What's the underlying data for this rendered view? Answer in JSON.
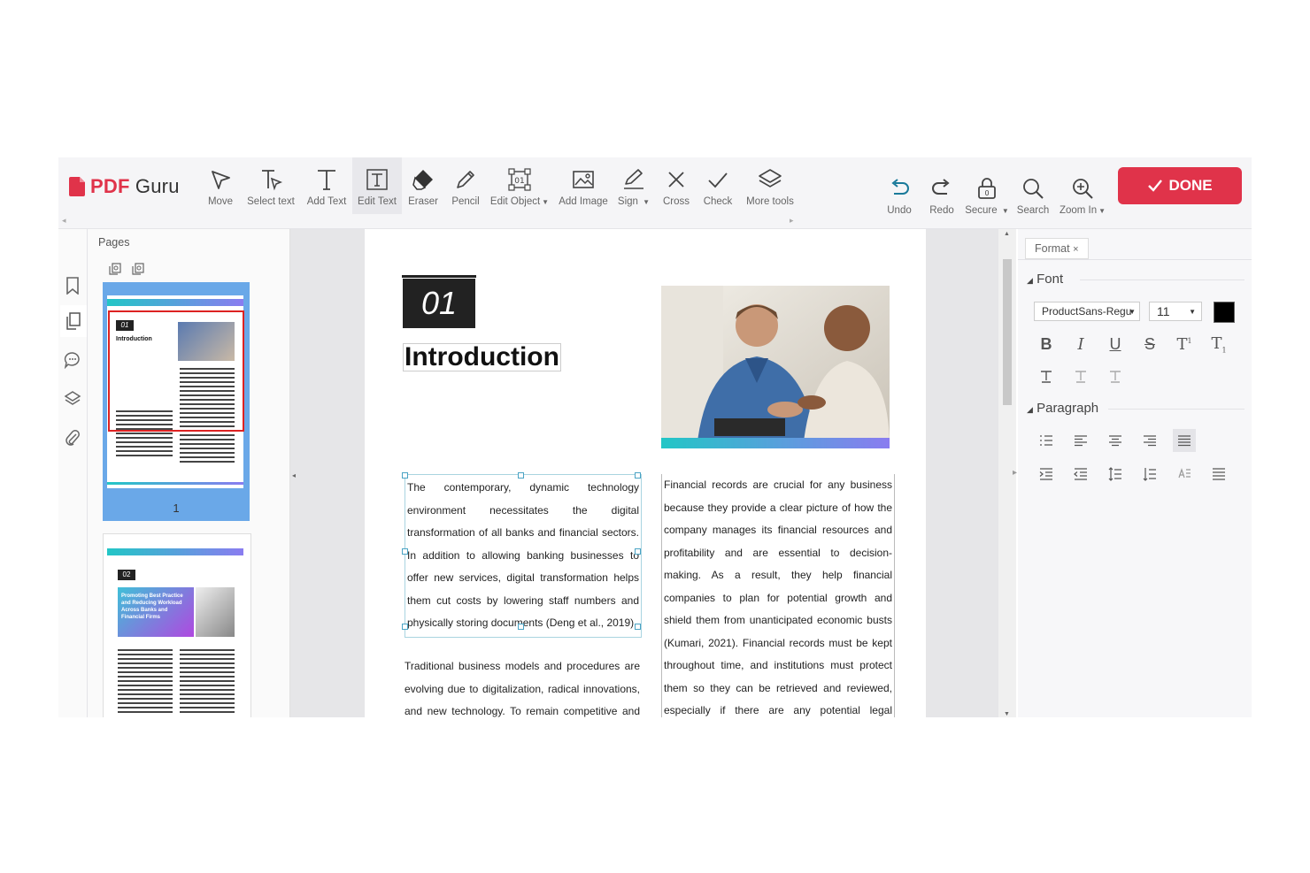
{
  "logo": {
    "pdf": "PDF",
    "guru": "Guru"
  },
  "toolbar": {
    "tools": [
      {
        "id": "move",
        "label": "Move",
        "icon": "cursor-icon"
      },
      {
        "id": "select-text",
        "label": "Select text",
        "icon": "select-text-icon"
      },
      {
        "id": "add-text",
        "label": "Add Text",
        "icon": "add-text-icon"
      },
      {
        "id": "edit-text",
        "label": "Edit Text",
        "icon": "edit-text-icon"
      },
      {
        "id": "eraser",
        "label": "Eraser",
        "icon": "eraser-icon"
      },
      {
        "id": "pencil",
        "label": "Pencil",
        "icon": "pencil-icon"
      },
      {
        "id": "edit-object",
        "label": "Edit Object",
        "icon": "edit-object-icon"
      },
      {
        "id": "add-image",
        "label": "Add Image",
        "icon": "image-icon"
      },
      {
        "id": "sign",
        "label": "Sign",
        "icon": "sign-icon"
      },
      {
        "id": "cross",
        "label": "Cross",
        "icon": "cross-icon"
      },
      {
        "id": "check",
        "label": "Check",
        "icon": "check-icon"
      },
      {
        "id": "more-tools",
        "label": "More tools",
        "icon": "layers-icon"
      }
    ],
    "right": [
      {
        "id": "undo",
        "label": "Undo",
        "icon": "undo-icon"
      },
      {
        "id": "redo",
        "label": "Redo",
        "icon": "redo-icon"
      },
      {
        "id": "secure",
        "label": "Secure",
        "icon": "lock-icon"
      },
      {
        "id": "search",
        "label": "Search",
        "icon": "search-icon"
      },
      {
        "id": "zoom-in",
        "label": "Zoom In",
        "icon": "zoom-in-icon"
      }
    ],
    "done_label": "DONE"
  },
  "pages_panel": {
    "title": "Pages",
    "thumbnails": [
      {
        "number": "1",
        "badge": "01",
        "heading": "Introduction"
      },
      {
        "badge": "02",
        "heading": "Promoting Best Practice and Reducing Workload Across Banks and Financial Firms"
      }
    ]
  },
  "document": {
    "section_number": "01",
    "heading": "Introduction",
    "para1": "The contemporary, dynamic technology environment necessitates the digital transformation of all banks and financial sectors. In addition to allowing banking businesses to offer new services, digital transformation helps them cut costs by lowering staff numbers and physically storing documents (Deng et al., 2019).",
    "para2": "Traditional business models and procedures are evolving due to digitalization, radical innovations, and new technology. To remain competitive and be",
    "para3": "Financial records are crucial for any business because they provide a clear picture of how the company manages its financial resources and profitability and are essential to decision-making. As a result, they help financial companies to plan for potential growth and shield them from unanticipated economic busts (Kumari, 2021). Financial records must be kept throughout time, and institutions must protect them so they can be retrieved and reviewed, especially if there are any potential legal repercussions. Authorized individuals can"
  },
  "format_panel": {
    "tab_label": "Format",
    "font_section": "Font",
    "font_family": "ProductSans-Regu",
    "font_size": "11",
    "font_color": "#000000",
    "paragraph_section": "Paragraph"
  }
}
